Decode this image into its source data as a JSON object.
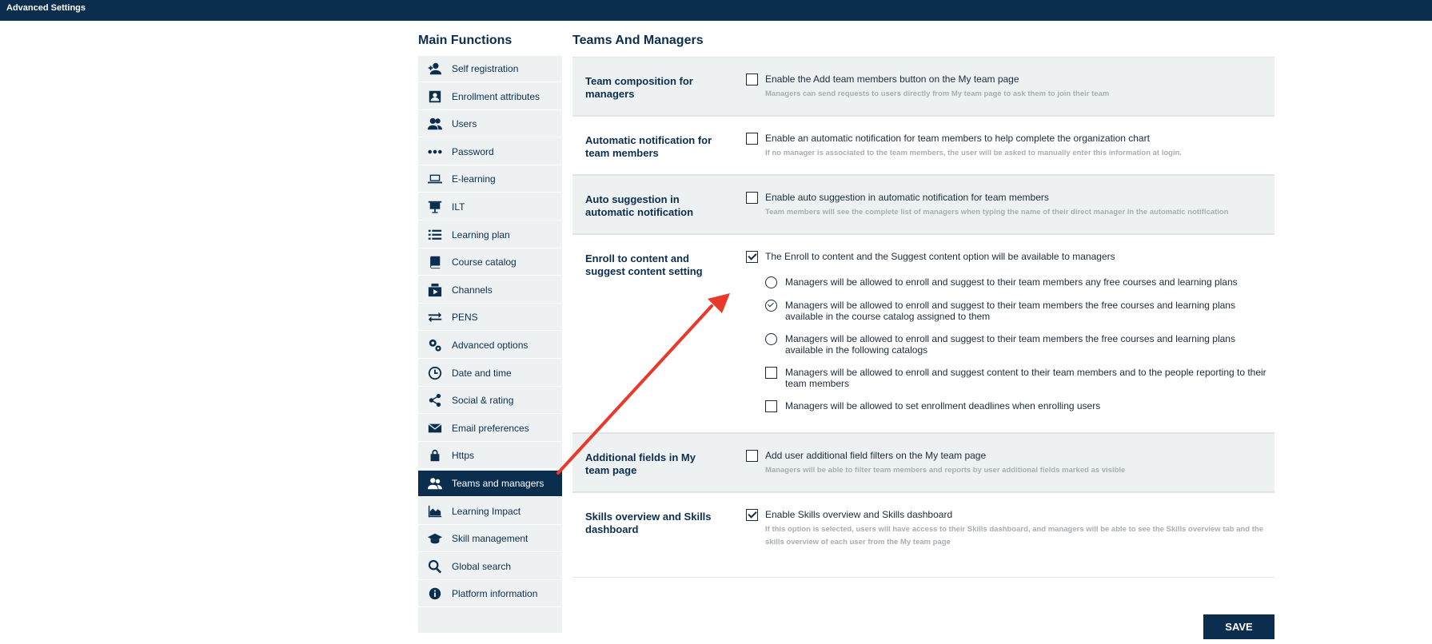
{
  "window": {
    "title": "Advanced Settings"
  },
  "sidebar": {
    "title": "Main Functions",
    "items": [
      {
        "label": "Self registration",
        "icon": "add-user-icon"
      },
      {
        "label": "Enrollment attributes",
        "icon": "id-card-icon"
      },
      {
        "label": "Users",
        "icon": "users-icon"
      },
      {
        "label": "Password",
        "icon": "dots-icon"
      },
      {
        "label": "E-learning",
        "icon": "laptop-icon"
      },
      {
        "label": "ILT",
        "icon": "presentation-icon"
      },
      {
        "label": "Learning plan",
        "icon": "list-icon"
      },
      {
        "label": "Course catalog",
        "icon": "book-icon"
      },
      {
        "label": "Channels",
        "icon": "channels-icon"
      },
      {
        "label": "PENS",
        "icon": "arrows-exchange-icon"
      },
      {
        "label": "Advanced options",
        "icon": "gears-icon"
      },
      {
        "label": "Date and time",
        "icon": "clock-icon"
      },
      {
        "label": "Social & rating",
        "icon": "share-icon"
      },
      {
        "label": "Email preferences",
        "icon": "envelope-icon"
      },
      {
        "label": "Https",
        "icon": "lock-icon"
      },
      {
        "label": "Teams and managers",
        "icon": "team-icon",
        "active": true
      },
      {
        "label": "Learning Impact",
        "icon": "area-chart-icon"
      },
      {
        "label": "Skill management",
        "icon": "graduation-cap-icon"
      },
      {
        "label": "Global search",
        "icon": "search-icon"
      },
      {
        "label": "Platform information",
        "icon": "info-icon"
      }
    ]
  },
  "main": {
    "title": "Teams And Managers",
    "sections": [
      {
        "label": "Team composition for managers",
        "checked": false,
        "option": "Enable the Add team members button on the My team page",
        "hint": "Managers can send requests to users directly from My team page to ask them to join their team"
      },
      {
        "label": "Automatic notification for team members",
        "checked": false,
        "option": "Enable an automatic notification for team members to help complete the organization chart",
        "hint": "If no manager is associated to the team members, the user will be asked to manually enter this information at login."
      },
      {
        "label": "Auto suggestion in automatic notification",
        "checked": false,
        "option": "Enable auto suggestion in automatic notification for team members",
        "hint": "Team members will see the complete list of managers when typing the name of their direct manager in the automatic notification"
      },
      {
        "label": "Enroll to content and suggest content setting",
        "checked": true,
        "option": "The Enroll to content and the Suggest content option will be available to managers",
        "suboptions": [
          {
            "type": "radio",
            "checked": false,
            "text": "Managers will be allowed to enroll and suggest to their team members any free courses and learning plans"
          },
          {
            "type": "radio",
            "checked": true,
            "text": "Managers will be allowed to enroll and suggest to their team members the free courses and learning plans available in the course catalog assigned to them"
          },
          {
            "type": "radio",
            "checked": false,
            "text": "Managers will be allowed to enroll and suggest to their team members the free courses and learning plans available in the following catalogs"
          },
          {
            "type": "checkbox",
            "checked": false,
            "text": "Managers will be allowed to enroll and suggest content to their team members and to the people reporting to their team members"
          },
          {
            "type": "checkbox",
            "checked": false,
            "text": "Managers will be allowed to set enrollment deadlines when enrolling users"
          }
        ]
      },
      {
        "label": "Additional fields in My team page",
        "checked": false,
        "option": "Add user additional field filters on the My team page",
        "hint": "Managers will be able to filter team members and reports by user additional fields marked as visible"
      },
      {
        "label": "Skills overview and Skills dashboard",
        "checked": true,
        "option": "Enable Skills overview and Skills dashboard",
        "hint": "If this option is selected, users will have access to their Skills dashboard, and managers will be able to see the Skills overview tab and the skills overview of each user from the My team page"
      }
    ],
    "save_label": "SAVE"
  },
  "colors": {
    "primary": "#0b2e4f",
    "panel": "#eef1f1",
    "hint": "#a6aeb3",
    "arrow": "#e8392a"
  }
}
